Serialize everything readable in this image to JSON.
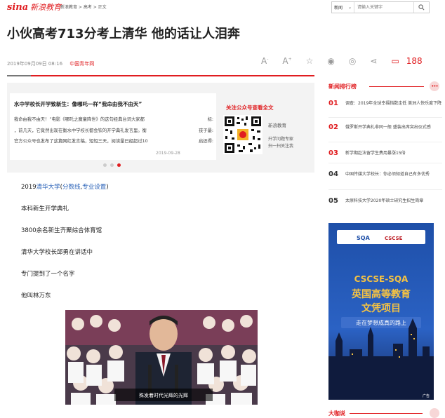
{
  "header": {
    "logo_sina": "sina",
    "logo_edu": "新浪教育",
    "breadcrumb": "新浪教育 > 高考 > 正文",
    "search": {
      "select_value": "新闻",
      "placeholder": "请输入关键字"
    }
  },
  "article": {
    "title": "小伙高考713分考上清华 他的话让人泪奔",
    "date": "2019年09月09日 08:16",
    "source": "中国青年网",
    "comment_count": "188",
    "paragraph_prefix": "2019",
    "link_school": "清华大学",
    "link_open": "(",
    "link_score": "分数线",
    "link_comma": ",",
    "link_major": "专业设置",
    "link_close": ")",
    "paragraphs": [
      "本科新生开学典礼",
      "3800余名新生齐聚综合体育馆",
      "清华大学校长邱勇在讲话中",
      "专门提到了一个名字",
      "他叫林万东"
    ],
    "photo_caption": "殊发着时代光辉的光辉"
  },
  "card": {
    "title": "水中学校长开学致新生：像哪吒一样“我命由我不由天”",
    "lines": [
      "我命由我不由天！”电影《哪吒之魔童降世》的这句经典台词大家都",
      "，前几天，它竟然出现在衡水中学校长都会钦的开学典礼发言里。衡",
      "官方公众号也发布了这篇网红发言稿，短短三天，阅读量已经超过10"
    ],
    "side_lines": [
      "标:",
      "孩子最:",
      "启还得:"
    ],
    "date": "2019-09-28",
    "qr_title": "关注公众号查看全文",
    "qr_name": "新浪教育",
    "qr_desc": [
      "升学问题专家",
      "扫一扫关注我"
    ]
  },
  "sidebar": {
    "ranking_title": "新闻排行榜",
    "ranking": [
      {
        "num": "01",
        "text": "调查：2019年全球幸福指数走低 美洲人快乐度下降"
      },
      {
        "num": "02",
        "text": "俄罗斯开学典礼非同一般 盛装出席突出仪式感"
      },
      {
        "num": "03",
        "text": "新学期赴法留学生费用暴涨15倍"
      },
      {
        "num": "04",
        "text": "中国传媒大学校长：你必须知道自己有多优秀"
      },
      {
        "num": "05",
        "text": "太原科技大学2020年硕士研究生招生简章"
      }
    ],
    "ad": {
      "brand1": "SQA",
      "brand2": "CSCSE",
      "headline": "CSCSE-SQA",
      "sub1": "英国高等教育",
      "sub2": "文凭项目",
      "tagline": "走在梦想成真的路上",
      "corner": "广告"
    },
    "bottom_title": "大咖说"
  },
  "colors": {
    "brand_red": "#e01d20",
    "link_blue": "#2a62b8"
  },
  "icons": [
    "font-decrease-icon",
    "font-increase-icon",
    "star-icon",
    "weibo-icon",
    "wechat-icon",
    "share-icon",
    "comment-icon",
    "search-icon",
    "more-icon"
  ]
}
